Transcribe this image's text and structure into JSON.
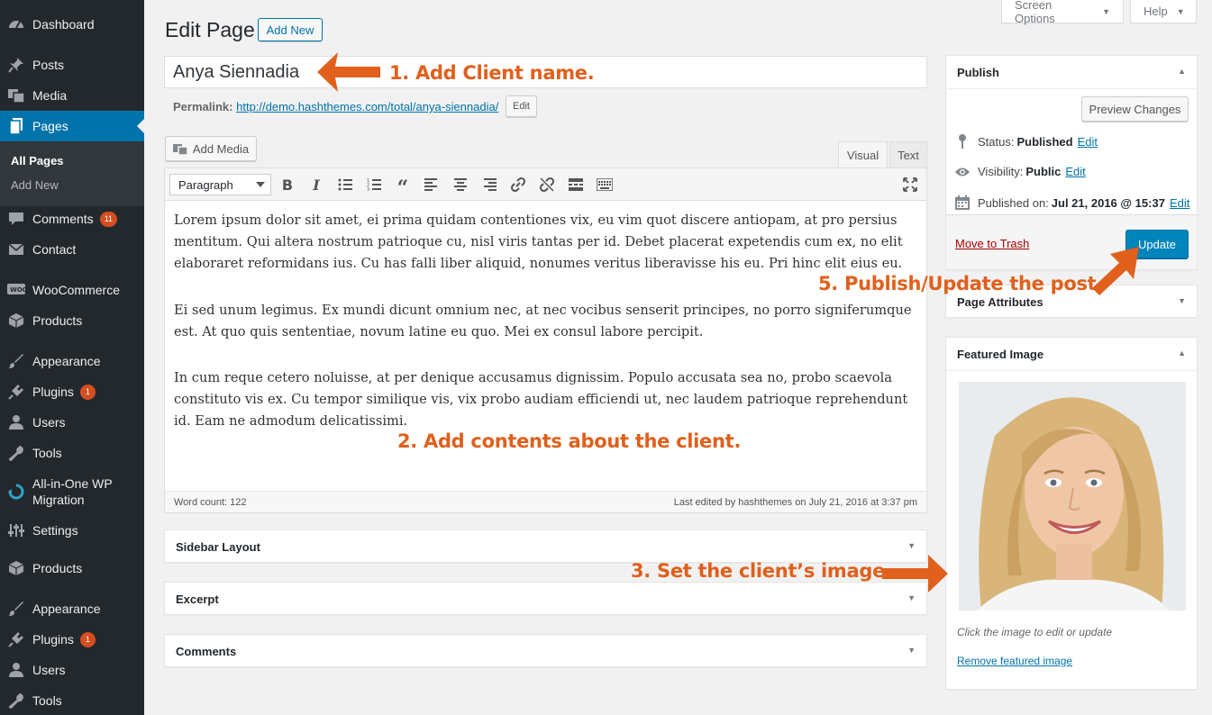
{
  "sidebar": {
    "items": [
      {
        "label": "Dashboard",
        "icon": "dashboard-icon"
      },
      {
        "label": "Posts",
        "icon": "pin-icon"
      },
      {
        "label": "Media",
        "icon": "media-icon"
      },
      {
        "label": "Pages",
        "icon": "pages-icon"
      },
      {
        "label": "Comments",
        "icon": "comment-icon",
        "badge": "11"
      },
      {
        "label": "Contact",
        "icon": "mail-icon"
      },
      {
        "label": "WooCommerce",
        "icon": "woocommerce-icon"
      },
      {
        "label": "Products",
        "icon": "box-icon"
      },
      {
        "label": "Appearance",
        "icon": "brush-icon"
      },
      {
        "label": "Plugins",
        "icon": "plug-icon",
        "badge": "1"
      },
      {
        "label": "Users",
        "icon": "user-icon"
      },
      {
        "label": "Tools",
        "icon": "wrench-icon"
      },
      {
        "label": "All-in-One WP Migration",
        "label_line1": "All-in-One WP",
        "label_line2": "Migration",
        "icon": "migration-icon"
      },
      {
        "label": "Settings",
        "icon": "settings-icon"
      },
      {
        "label": "Products",
        "icon": "box-icon"
      },
      {
        "label": "Appearance",
        "icon": "brush-icon"
      },
      {
        "label": "Plugins",
        "icon": "plug-icon",
        "badge": "1"
      },
      {
        "label": "Users",
        "icon": "user-icon"
      },
      {
        "label": "Tools",
        "icon": "wrench-icon"
      }
    ],
    "submenu": {
      "all_pages": "All Pages",
      "add_new": "Add New"
    },
    "accent": "#0073aa",
    "badge_color": "#d54e21"
  },
  "screen_meta": {
    "screen_options": "Screen Options",
    "help": "Help"
  },
  "page": {
    "title": "Edit Page",
    "add_new": "Add New"
  },
  "post": {
    "title": "Anya Siennadia",
    "permalink_label": "Permalink:",
    "permalink_url": "http://demo.hashthemes.com/total/anya-siennadia/",
    "permalink_edit": "Edit"
  },
  "editor": {
    "add_media": "Add Media",
    "tab_visual": "Visual",
    "tab_text": "Text",
    "format": "Paragraph",
    "paragraphs": [
      "Lorem ipsum dolor sit amet, ei prima quidam contentiones vix, eu vim quot discere antiopam, at pro persius mentitum. Qui altera nostrum patrioque cu, nisl viris tantas per id. Debet placerat expetendis cum ex, no elit elaboraret reformidans ius. Cu has falli liber aliquid, nonumes veritus liberavisse his eu. Pri hinc elit eius eu.",
      "Ei sed unum legimus. Ex mundi dicunt omnium nec, at nec vocibus senserit principes, no porro signiferumque est. At quo quis sententiae, novum latine eu quo. Mei ex consul labore percipit.",
      "In cum reque cetero noluisse, at per denique accusamus dignissim. Populo accusata sea no, probo scaevola constituto vis ex. Cu tempor similique vis, vix probo audiam efficiendi ut, nec laudem patrioque reprehendunt id. Eam ne admodum delicatissimi."
    ],
    "word_count": "Word count: 122",
    "last_edited": "Last edited by hashthemes on July 21, 2016 at 3:37 pm"
  },
  "metaboxes": {
    "sidebar_layout": "Sidebar Layout",
    "excerpt": "Excerpt",
    "comments": "Comments",
    "page_attributes": "Page Attributes"
  },
  "publish": {
    "title": "Publish",
    "preview": "Preview Changes",
    "status_label": "Status:",
    "status_value": "Published",
    "visibility_label": "Visibility:",
    "visibility_value": "Public",
    "published_label": "Published on:",
    "published_value": "Jul 21, 2016 @ 15:37",
    "edit": "Edit",
    "trash": "Move to Trash",
    "update": "Update"
  },
  "featured": {
    "title": "Featured Image",
    "hint": "Click the image to edit or update",
    "remove": "Remove featured image"
  },
  "annotations": {
    "a1": "1. Add Client name.",
    "a2": "2. Add contents about the client.",
    "a3": "3. Set the client’s image.",
    "a5": "5. Publish/Update the post.",
    "color": "#e0601c"
  }
}
